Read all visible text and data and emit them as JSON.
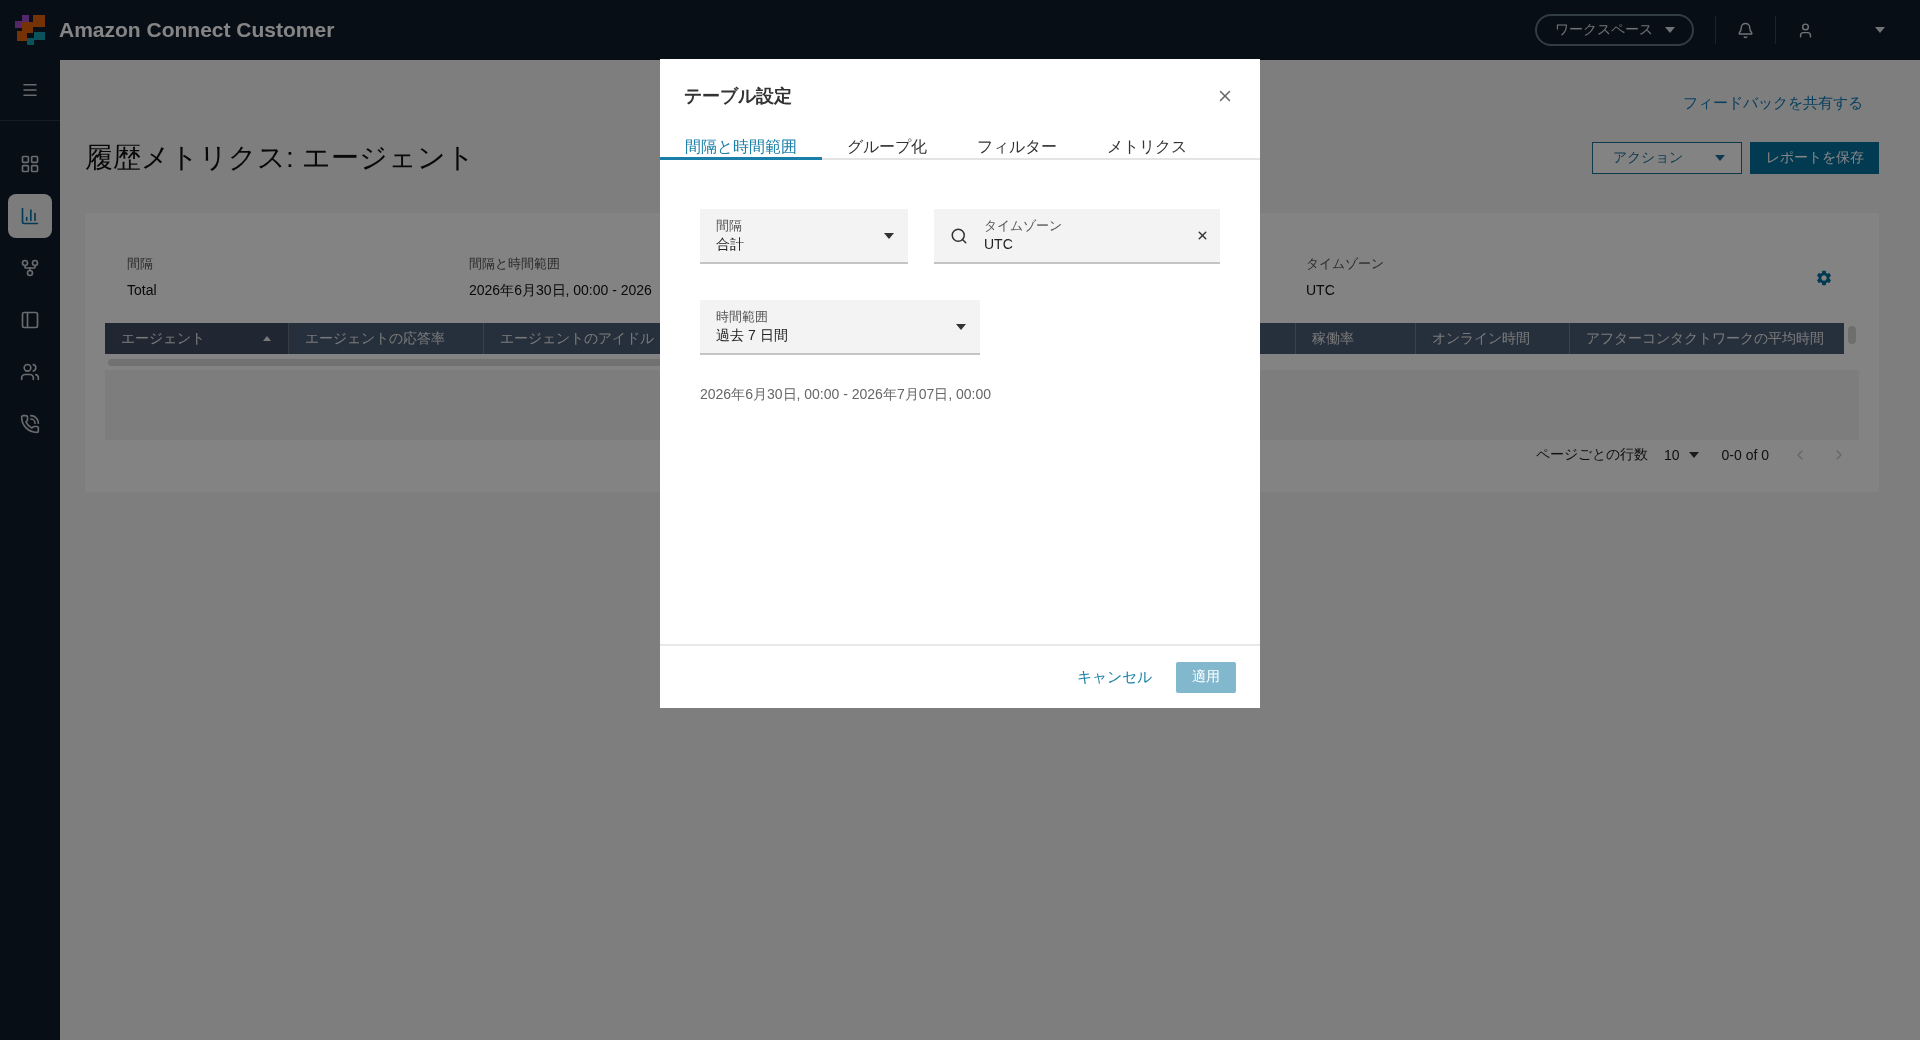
{
  "top_bar": {
    "title": "Amazon Connect Customer",
    "workspace_button": "ワークスペース"
  },
  "sidebar": {
    "items": [
      {
        "selected": false
      },
      {
        "selected": true
      },
      {
        "selected": false
      },
      {
        "selected": false
      },
      {
        "selected": false
      },
      {
        "selected": false
      }
    ]
  },
  "page": {
    "feedback_link": "フィードバックを共有する",
    "title": "履歴メトリクス: エージェント",
    "actions_button": "アクション",
    "save_button": "レポートを保存"
  },
  "summary": [
    {
      "label": "間隔",
      "value": "Total"
    },
    {
      "label": "間隔と時間範囲",
      "value": "2026年6月30日, 00:00 - 2026"
    },
    {
      "label": "タイムゾーン",
      "value": "UTC"
    }
  ],
  "table": {
    "columns": [
      {
        "label": "エージェント",
        "sorted": true
      },
      {
        "label": "エージェントの応答率",
        "sorted": false
      },
      {
        "label": "エージェントのアイドル",
        "sorted": false
      },
      {
        "label": "稼働率",
        "sorted": false
      },
      {
        "label": "オンライン時間",
        "sorted": false
      },
      {
        "label": "アフターコンタクトワークの平均時間",
        "sorted": false
      }
    ]
  },
  "pagination": {
    "rows_label": "ページごとの行数",
    "rows_value": "10",
    "range": "0-0 of 0",
    "previous_disabled": true,
    "next_disabled": true
  },
  "modal": {
    "title": "テーブル設定",
    "tabs": [
      {
        "label": "間隔と時間範囲",
        "selected": true
      },
      {
        "label": "グループ化",
        "selected": false
      },
      {
        "label": "フィルター",
        "selected": false
      },
      {
        "label": "メトリクス",
        "selected": false
      }
    ],
    "fields": [
      {
        "kind": "select",
        "label": "間隔",
        "value": "合計"
      },
      {
        "kind": "search",
        "label": "タイムゾーン",
        "value": "UTC"
      },
      {
        "kind": "select",
        "label": "時間範囲",
        "value": "過去 7 日間"
      }
    ],
    "range_text": "2026年6月30日, 00:00 - 2026年7月07日, 00:00",
    "cancel_button": "キャンセル",
    "apply_button": {
      "label": "適用",
      "disabled": true
    }
  }
}
